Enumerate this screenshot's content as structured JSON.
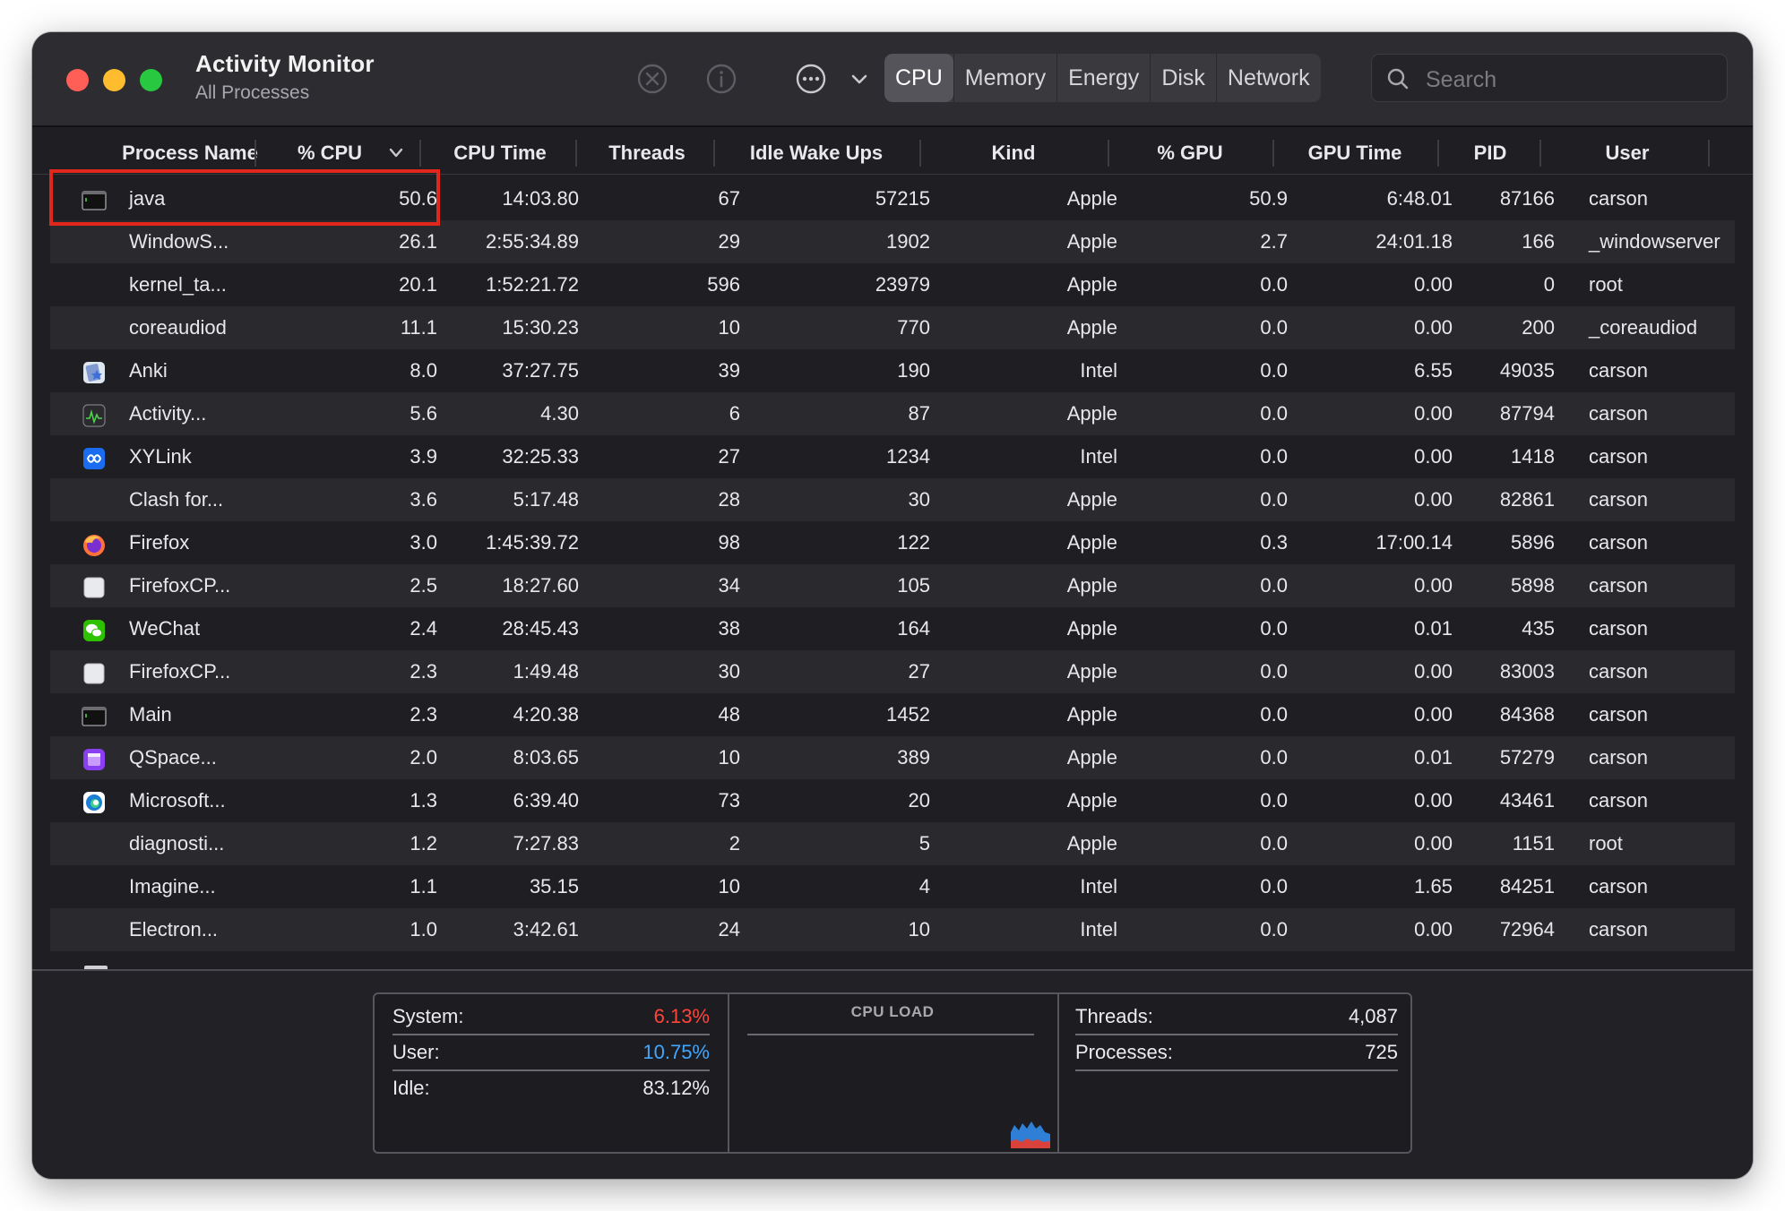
{
  "window": {
    "title": "Activity Monitor",
    "subtitle": "All Processes"
  },
  "toolbar": {
    "stop_icon": "stop-process-x-icon",
    "info_icon": "info-icon",
    "more_icon": "ellipsis-circle-icon",
    "tabs": [
      "CPU",
      "Memory",
      "Energy",
      "Disk",
      "Network"
    ],
    "active_tab": "CPU",
    "search_placeholder": "Search"
  },
  "columns": {
    "name": "Process Name",
    "cpu": "% CPU",
    "cpu_time": "CPU Time",
    "threads": "Threads",
    "idle_wake_ups": "Idle Wake Ups",
    "kind": "Kind",
    "gpu": "% GPU",
    "gpu_time": "GPU Time",
    "pid": "PID",
    "user": "User",
    "sorted_by": "% CPU",
    "sort_direction": "descending"
  },
  "processes": [
    {
      "name": "java",
      "cpu": "50.6",
      "cpu_time": "14:03.80",
      "threads": "67",
      "idle": "57215",
      "kind": "Apple",
      "gpu": "50.9",
      "gpu_time": "6:48.01",
      "pid": "87166",
      "user": "carson",
      "icon": "terminal-icon"
    },
    {
      "name": "WindowS...",
      "cpu": "26.1",
      "cpu_time": "2:55:34.89",
      "threads": "29",
      "idle": "1902",
      "kind": "Apple",
      "gpu": "2.7",
      "gpu_time": "24:01.18",
      "pid": "166",
      "user": "_windowserver",
      "icon": ""
    },
    {
      "name": "kernel_ta...",
      "cpu": "20.1",
      "cpu_time": "1:52:21.72",
      "threads": "596",
      "idle": "23979",
      "kind": "Apple",
      "gpu": "0.0",
      "gpu_time": "0.00",
      "pid": "0",
      "user": "root",
      "icon": ""
    },
    {
      "name": "coreaudiod",
      "cpu": "11.1",
      "cpu_time": "15:30.23",
      "threads": "10",
      "idle": "770",
      "kind": "Apple",
      "gpu": "0.0",
      "gpu_time": "0.00",
      "pid": "200",
      "user": "_coreaudiod",
      "icon": ""
    },
    {
      "name": "Anki",
      "cpu": "8.0",
      "cpu_time": "37:27.75",
      "threads": "39",
      "idle": "190",
      "kind": "Intel",
      "gpu": "0.0",
      "gpu_time": "6.55",
      "pid": "49035",
      "user": "carson",
      "icon": "anki-icon"
    },
    {
      "name": "Activity...",
      "cpu": "5.6",
      "cpu_time": "4.30",
      "threads": "6",
      "idle": "87",
      "kind": "Apple",
      "gpu": "0.0",
      "gpu_time": "0.00",
      "pid": "87794",
      "user": "carson",
      "icon": "activity-monitor-icon"
    },
    {
      "name": "XYLink",
      "cpu": "3.9",
      "cpu_time": "32:25.33",
      "threads": "27",
      "idle": "1234",
      "kind": "Intel",
      "gpu": "0.0",
      "gpu_time": "0.00",
      "pid": "1418",
      "user": "carson",
      "icon": "xylink-icon"
    },
    {
      "name": "Clash for...",
      "cpu": "3.6",
      "cpu_time": "5:17.48",
      "threads": "28",
      "idle": "30",
      "kind": "Apple",
      "gpu": "0.0",
      "gpu_time": "0.00",
      "pid": "82861",
      "user": "carson",
      "icon": ""
    },
    {
      "name": "Firefox",
      "cpu": "3.0",
      "cpu_time": "1:45:39.72",
      "threads": "98",
      "idle": "122",
      "kind": "Apple",
      "gpu": "0.3",
      "gpu_time": "17:00.14",
      "pid": "5896",
      "user": "carson",
      "icon": "firefox-icon"
    },
    {
      "name": "FirefoxCP...",
      "cpu": "2.5",
      "cpu_time": "18:27.60",
      "threads": "34",
      "idle": "105",
      "kind": "Apple",
      "gpu": "0.0",
      "gpu_time": "0.00",
      "pid": "5898",
      "user": "carson",
      "icon": "generic-app-icon"
    },
    {
      "name": "WeChat",
      "cpu": "2.4",
      "cpu_time": "28:45.43",
      "threads": "38",
      "idle": "164",
      "kind": "Apple",
      "gpu": "0.0",
      "gpu_time": "0.01",
      "pid": "435",
      "user": "carson",
      "icon": "wechat-icon"
    },
    {
      "name": "FirefoxCP...",
      "cpu": "2.3",
      "cpu_time": "1:49.48",
      "threads": "30",
      "idle": "27",
      "kind": "Apple",
      "gpu": "0.0",
      "gpu_time": "0.00",
      "pid": "83003",
      "user": "carson",
      "icon": "generic-app-icon"
    },
    {
      "name": "Main",
      "cpu": "2.3",
      "cpu_time": "4:20.38",
      "threads": "48",
      "idle": "1452",
      "kind": "Apple",
      "gpu": "0.0",
      "gpu_time": "0.00",
      "pid": "84368",
      "user": "carson",
      "icon": "terminal-icon"
    },
    {
      "name": "QSpace...",
      "cpu": "2.0",
      "cpu_time": "8:03.65",
      "threads": "10",
      "idle": "389",
      "kind": "Apple",
      "gpu": "0.0",
      "gpu_time": "0.01",
      "pid": "57279",
      "user": "carson",
      "icon": "qspace-icon"
    },
    {
      "name": "Microsoft...",
      "cpu": "1.3",
      "cpu_time": "6:39.40",
      "threads": "73",
      "idle": "20",
      "kind": "Apple",
      "gpu": "0.0",
      "gpu_time": "0.00",
      "pid": "43461",
      "user": "carson",
      "icon": "edge-icon"
    },
    {
      "name": "diagnosti...",
      "cpu": "1.2",
      "cpu_time": "7:27.83",
      "threads": "2",
      "idle": "5",
      "kind": "Apple",
      "gpu": "0.0",
      "gpu_time": "0.00",
      "pid": "1151",
      "user": "root",
      "icon": ""
    },
    {
      "name": "Imagine...",
      "cpu": "1.1",
      "cpu_time": "35.15",
      "threads": "10",
      "idle": "4",
      "kind": "Intel",
      "gpu": "0.0",
      "gpu_time": "1.65",
      "pid": "84251",
      "user": "carson",
      "icon": ""
    },
    {
      "name": "Electron...",
      "cpu": "1.0",
      "cpu_time": "3:42.61",
      "threads": "24",
      "idle": "10",
      "kind": "Intel",
      "gpu": "0.0",
      "gpu_time": "0.00",
      "pid": "72964",
      "user": "carson",
      "icon": ""
    }
  ],
  "highlighted_process": "java",
  "summary": {
    "system_label": "System:",
    "system_value": "6.13%",
    "user_label": "User:",
    "user_value": "10.75%",
    "idle_label": "Idle:",
    "idle_value": "83.12%",
    "cpu_load_title": "CPU LOAD",
    "threads_label": "Threads:",
    "threads_value": "4,087",
    "processes_label": "Processes:",
    "processes_value": "725"
  },
  "colors": {
    "system": "#ff453a",
    "user": "#40a7ff",
    "idle": "#ececef",
    "highlight_box": "#e1261c"
  }
}
